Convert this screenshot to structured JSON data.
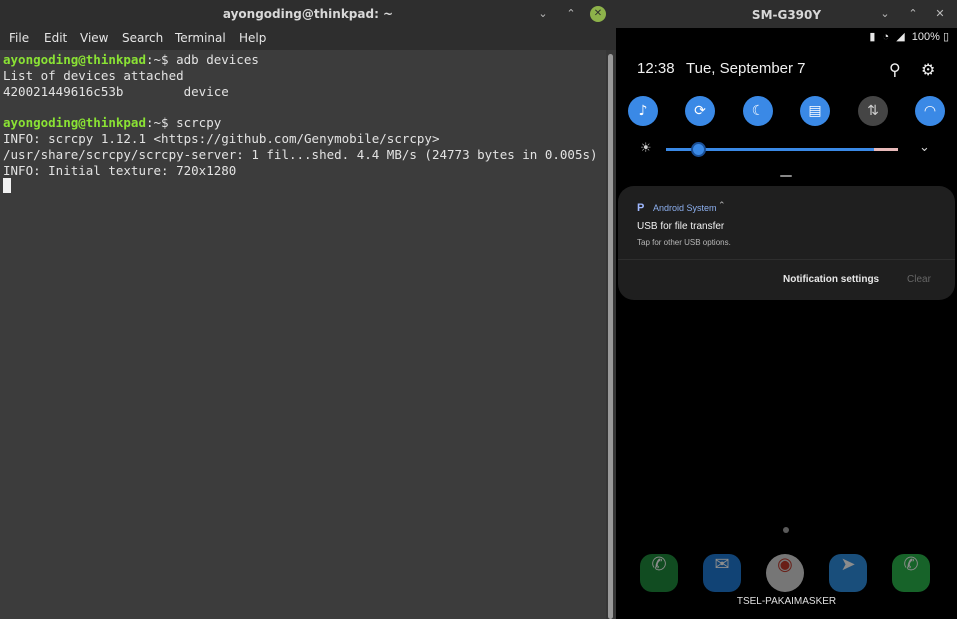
{
  "terminal": {
    "title": "ayongoding@thinkpad: ~",
    "window_buttons": {
      "minimize": "⌄",
      "maximize": "⌃",
      "close": "✕"
    },
    "menu": [
      "File",
      "Edit",
      "View",
      "Search",
      "Terminal",
      "Help"
    ],
    "lines": [
      {
        "prompt": "ayongoding@thinkpad",
        "rest": ":~$ adb devices"
      },
      {
        "text": "List of devices attached"
      },
      {
        "text": "420021449616c53b        device"
      },
      {
        "text": ""
      },
      {
        "prompt": "ayongoding@thinkpad",
        "rest": ":~$ scrcpy"
      },
      {
        "text": "INFO: scrcpy 1.12.1 <https://github.com/Genymobile/scrcpy>"
      },
      {
        "text": "/usr/share/scrcpy/scrcpy-server: 1 fil...shed. 4.4 MB/s (24773 bytes in 0.005s)"
      },
      {
        "text": "INFO: Initial texture: 720x1280"
      }
    ]
  },
  "phone": {
    "title": "SM-G390Y",
    "window_buttons": {
      "minimize": "⌄",
      "maximize": "⌃",
      "close": "✕"
    },
    "status": {
      "battery": "100%"
    },
    "clock": "12:38",
    "date": "Tue, September 7",
    "header_icons": [
      "search-icon",
      "gear-icon"
    ],
    "quick_settings": [
      {
        "name": "sound-icon",
        "on": true
      },
      {
        "name": "rotation-lock-icon",
        "on": true
      },
      {
        "name": "night-mode-icon",
        "on": true
      },
      {
        "name": "portrait-icon",
        "on": true
      },
      {
        "name": "mobile-data-icon",
        "on": false
      },
      {
        "name": "wifi-icon",
        "on": true
      }
    ],
    "notification": {
      "app_icon": "P",
      "app_name": "Android System",
      "title": "USB for file transfer",
      "subtitle": "Tap for other USB options.",
      "settings_label": "Notification settings",
      "clear_label": "Clear"
    },
    "dock": [
      "phone-icon",
      "messages-icon",
      "chrome-icon",
      "telegram-icon",
      "whatsapp-icon"
    ],
    "carrier": "TSEL-PAKAIMASKER"
  }
}
